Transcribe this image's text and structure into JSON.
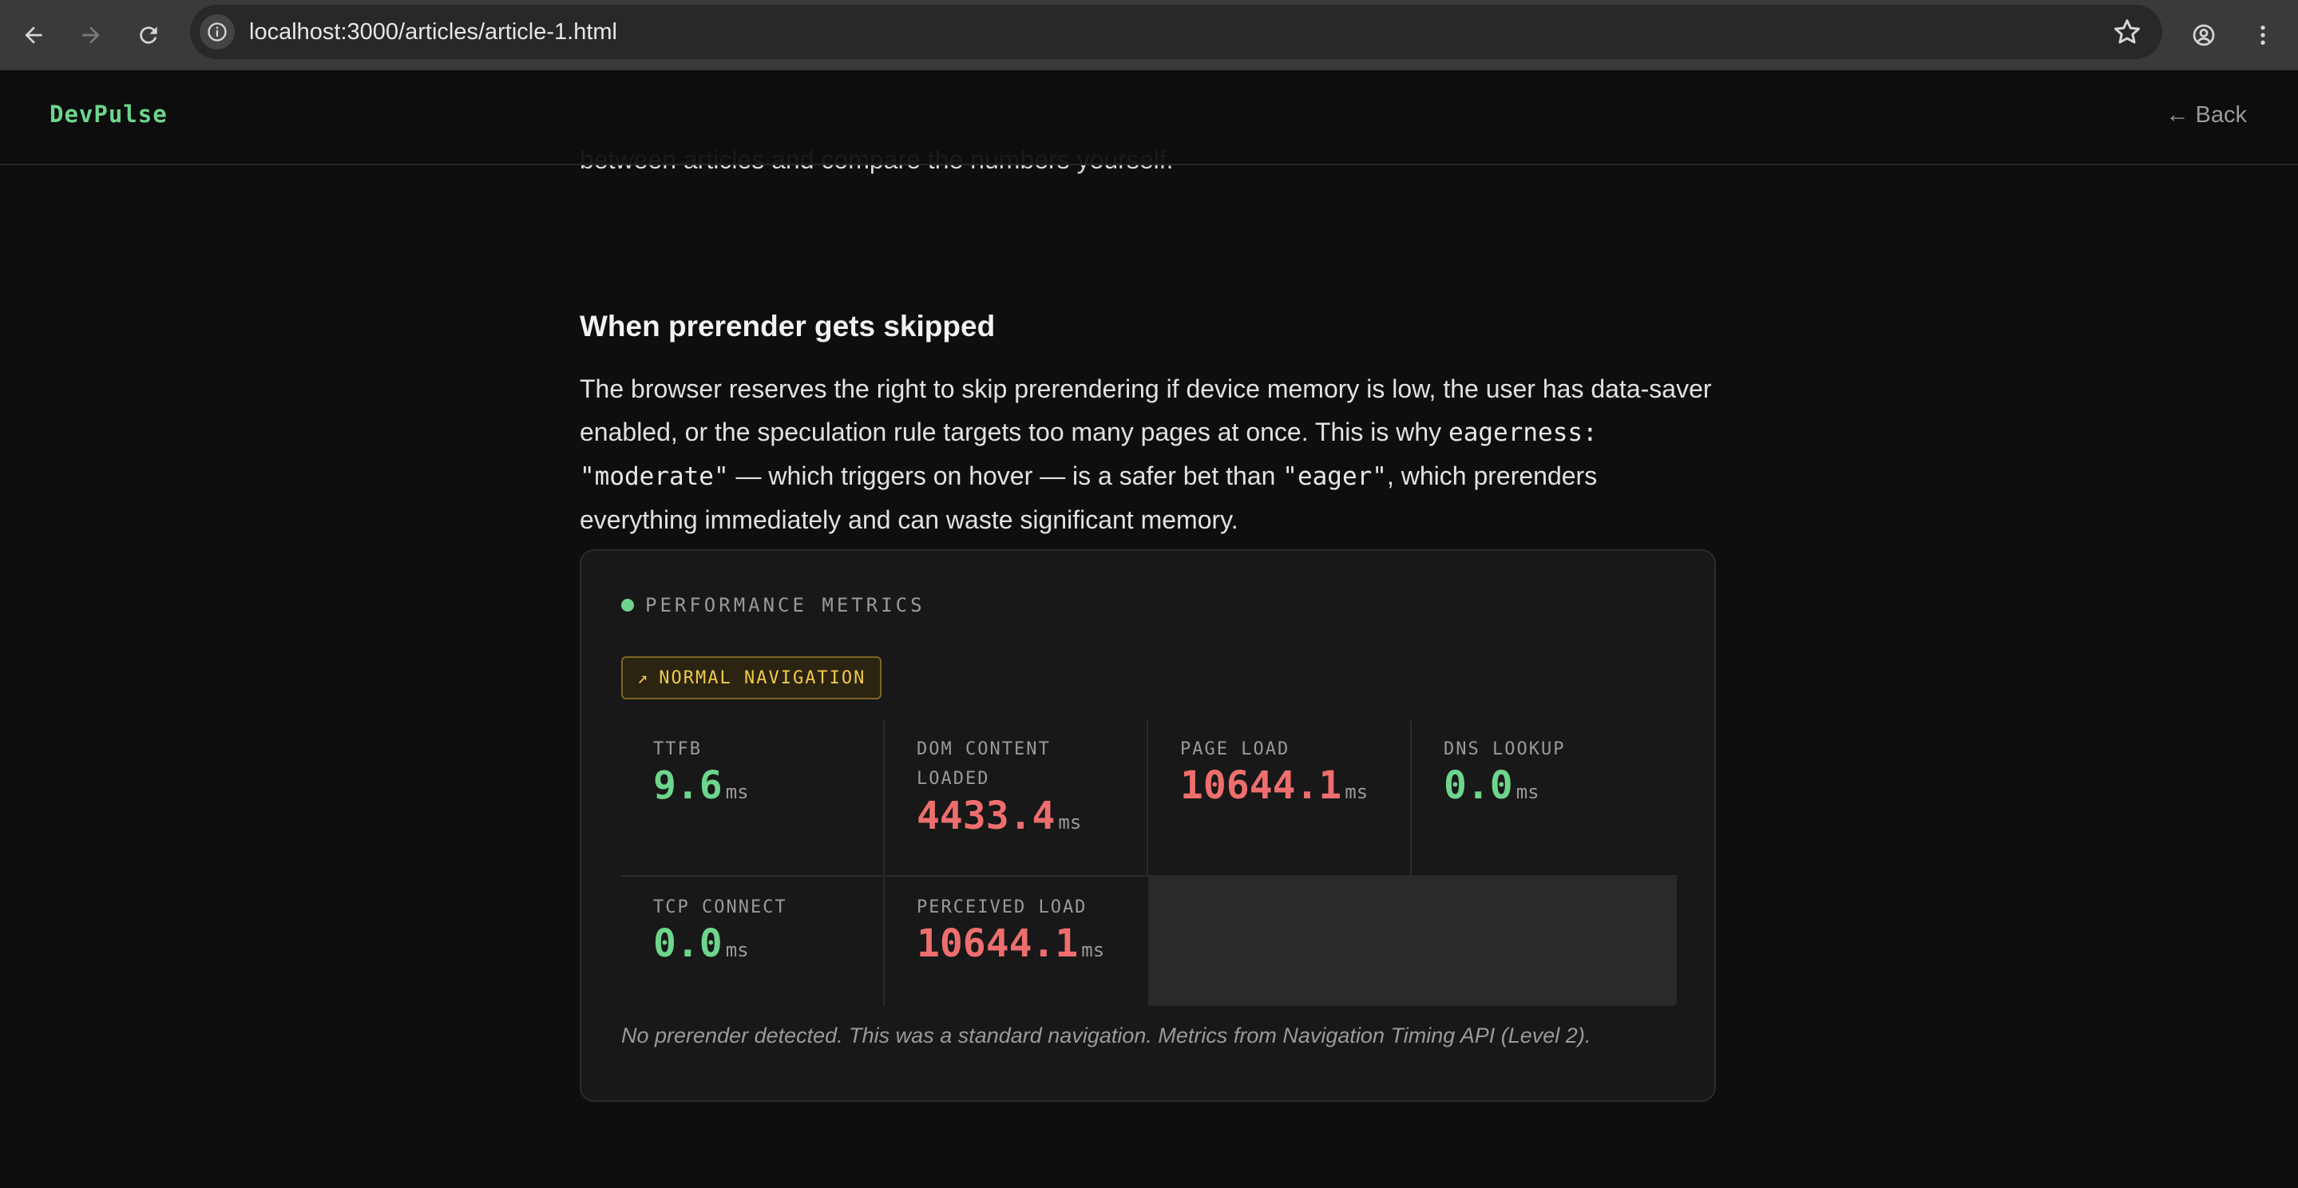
{
  "browser": {
    "url_host": "localhost",
    "url_rest": ":3000/articles/article-1.html"
  },
  "site": {
    "brand": "DevPulse",
    "back_label": "← Back"
  },
  "article": {
    "prev_line": "between articles and compare the numbers yourself.",
    "heading": "When prerender gets skipped",
    "para_part1": "The browser reserves the right to skip prerendering if device memory is low, the user has data-saver enabled, or the speculation rule targets too many pages at once. This is why ",
    "code1": "eagerness: \"moderate\"",
    "para_part2": " — which triggers on hover — is a safer bet than ",
    "code2": "\"eager\"",
    "para_part3": ", which prerenders everything immediately and can waste significant memory."
  },
  "metrics": {
    "title": "PERFORMANCE METRICS",
    "badge_icon": "↗",
    "badge_label": "NORMAL NAVIGATION",
    "cells": [
      {
        "label": "TTFB",
        "value": "9.6",
        "unit": "ms",
        "status": "good"
      },
      {
        "label": "DOM CONTENT LOADED",
        "value": "4433.4",
        "unit": "ms",
        "status": "bad"
      },
      {
        "label": "PAGE LOAD",
        "value": "10644.1",
        "unit": "ms",
        "status": "bad"
      },
      {
        "label": "DNS LOOKUP",
        "value": "0.0",
        "unit": "ms",
        "status": "good"
      },
      {
        "label": "TCP CONNECT",
        "value": "0.0",
        "unit": "ms",
        "status": "good"
      },
      {
        "label": "PERCEIVED LOAD",
        "value": "10644.1",
        "unit": "ms",
        "status": "bad"
      }
    ],
    "footnote": "No prerender detected. This was a standard navigation. Metrics from Navigation Timing API (Level 2)."
  },
  "colors": {
    "good": "#6dd58c",
    "bad": "#ee6e6e",
    "badge": "#f2c94c"
  }
}
